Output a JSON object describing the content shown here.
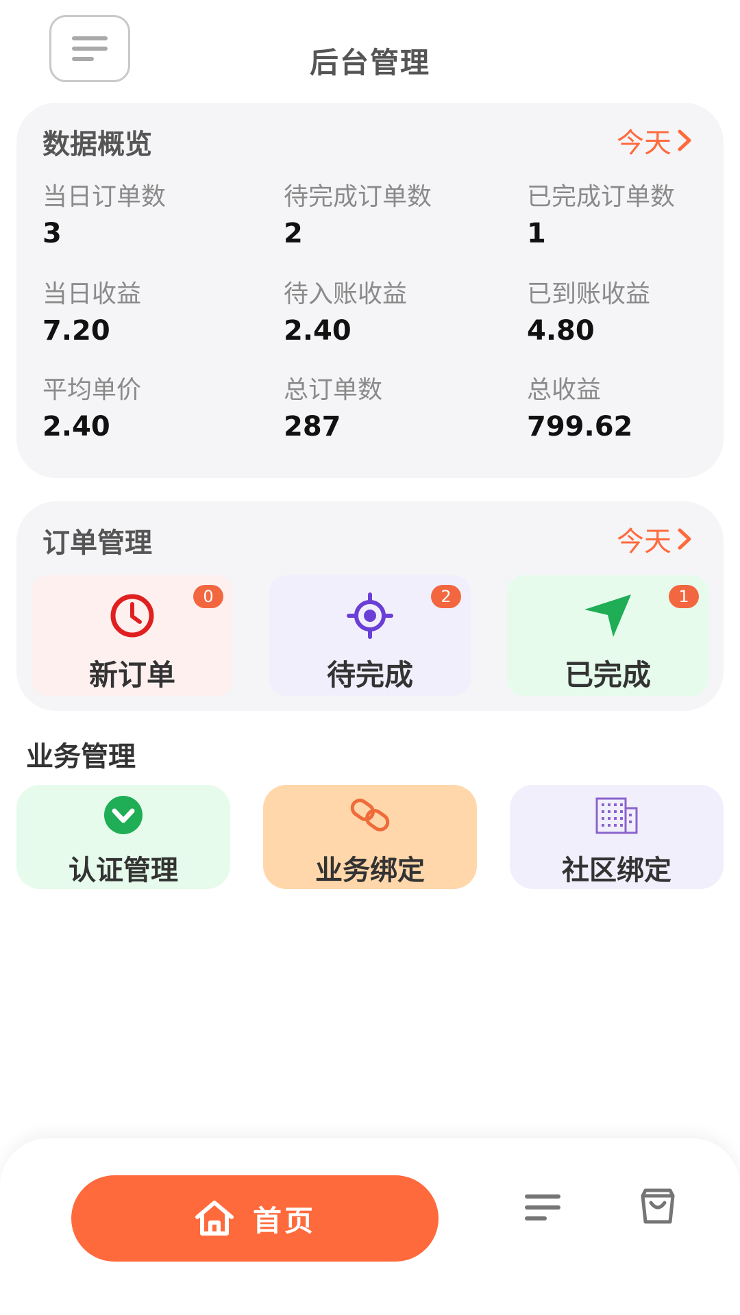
{
  "header": {
    "title": "后台管理",
    "menu_icon": "menu-lines-icon"
  },
  "overview": {
    "title": "数据概览",
    "link_label": "今天",
    "stats": [
      {
        "label": "当日订单数",
        "value": "3"
      },
      {
        "label": "待完成订单数",
        "value": "2"
      },
      {
        "label": "已完成订单数",
        "value": "1"
      },
      {
        "label": "当日收益",
        "value": "7.20"
      },
      {
        "label": "待入账收益",
        "value": "2.40"
      },
      {
        "label": "已到账收益",
        "value": "4.80"
      },
      {
        "label": "平均单价",
        "value": "2.40"
      },
      {
        "label": "总订单数",
        "value": "287"
      },
      {
        "label": "总收益",
        "value": "799.62"
      }
    ]
  },
  "orders": {
    "title": "订单管理",
    "link_label": "今天",
    "tiles": [
      {
        "label": "新订单",
        "badge": "0",
        "icon": "clock-icon",
        "bg": "#fff0f0",
        "color": "#e02020"
      },
      {
        "label": "待完成",
        "badge": "2",
        "icon": "target-icon",
        "bg": "#f2effd",
        "color": "#6a3fd6"
      },
      {
        "label": "已完成",
        "badge": "1",
        "icon": "send-arrow-icon",
        "bg": "#e6fbec",
        "color": "#1fad55"
      }
    ]
  },
  "business": {
    "title": "业务管理",
    "tiles": [
      {
        "label": "认证管理",
        "icon": "check-chevron-icon",
        "bg": "#e6fbec",
        "color": "#1fad55"
      },
      {
        "label": "业务绑定",
        "icon": "link-icon",
        "bg": "#ffd7aa",
        "color": "#f06a3a"
      },
      {
        "label": "社区绑定",
        "icon": "building-icon",
        "bg": "#f2effd",
        "color": "#8a64cc"
      }
    ]
  },
  "tabbar": {
    "home_label": "首页",
    "items": [
      {
        "name": "home",
        "icon": "home-icon"
      },
      {
        "name": "list",
        "icon": "list-lines-icon"
      },
      {
        "name": "bag",
        "icon": "shopping-bag-icon"
      }
    ],
    "accent": "#ff6a3d"
  }
}
